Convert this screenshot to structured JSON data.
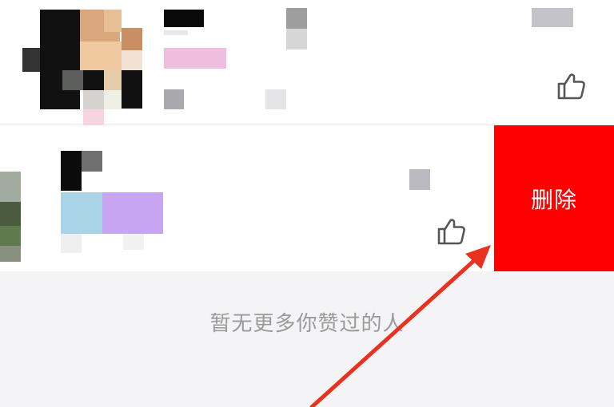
{
  "list": {
    "items": [
      {
        "id": "row-1"
      },
      {
        "id": "row-2",
        "action_label": "删除"
      }
    ]
  },
  "footer": {
    "empty_text": "暂无更多你赞过的人"
  },
  "colors": {
    "delete_bg": "#ff0000",
    "footer_text": "#9a9a9a",
    "annotation_arrow": "#e8311f"
  },
  "icons": {
    "like": "thumbs-up-icon",
    "annotation": "red-arrow"
  }
}
